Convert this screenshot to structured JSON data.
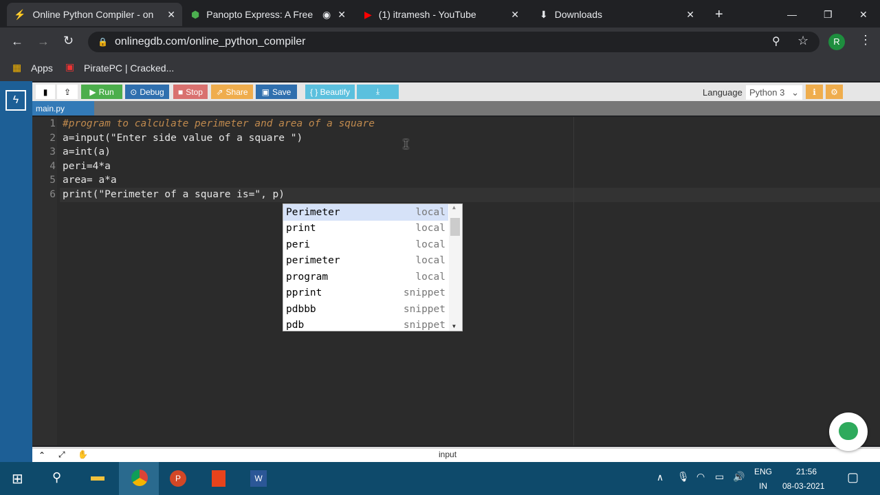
{
  "browser": {
    "tabs": [
      {
        "title": "Online Python Compiler - on",
        "active": true
      },
      {
        "title": "Panopto Express: A Free"
      },
      {
        "title": "(1) itramesh - YouTube"
      },
      {
        "title": "Downloads"
      }
    ],
    "url": "onlinegdb.com/online_python_compiler",
    "bookmarks": [
      "Apps",
      "PiratePC | Cracked..."
    ],
    "profile": "R"
  },
  "toolbar": {
    "run": "Run",
    "debug": "Debug",
    "stop": "Stop",
    "share": "Share",
    "save": "Save",
    "beautify": "{ } Beautify",
    "language_label": "Language",
    "language": "Python 3"
  },
  "file_tab": "main.py",
  "code": [
    "#program to calculate perimeter and area of a square",
    "a=input(\"Enter side value of a square \")",
    "a=int(a)",
    "peri=4*a",
    "area= a*a",
    "print(\"Perimeter of a square is=\", p)"
  ],
  "line_numbers": [
    "1",
    "2",
    "3",
    "4",
    "5",
    "6"
  ],
  "autocomplete": [
    {
      "label": "Perimeter",
      "kind": "local"
    },
    {
      "label": "print",
      "kind": "local"
    },
    {
      "label": "peri",
      "kind": "local"
    },
    {
      "label": "perimeter",
      "kind": "local"
    },
    {
      "label": "program",
      "kind": "local"
    },
    {
      "label": "pprint",
      "kind": "snippet"
    },
    {
      "label": "pdbbb",
      "kind": "snippet"
    },
    {
      "label": "pdb",
      "kind": "snippet"
    }
  ],
  "bottom_panel": "input",
  "taskbar": {
    "lang1": "ENG",
    "lang2": "IN",
    "time": "21:56",
    "date": "08-03-2021"
  }
}
